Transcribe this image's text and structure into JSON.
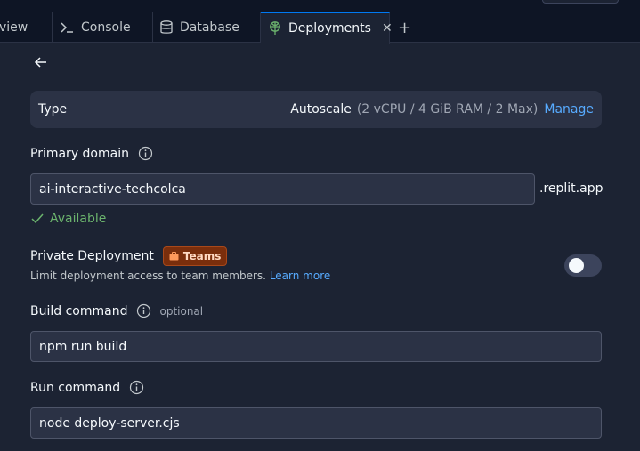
{
  "tabs": [
    {
      "label": "view",
      "icon": "none"
    },
    {
      "label": "Console",
      "icon": "terminal-icon"
    },
    {
      "label": "Database",
      "icon": "database-icon"
    },
    {
      "label": "Deployments",
      "icon": "deployments-icon",
      "active": true
    }
  ],
  "deployment": {
    "type_label": "Type",
    "type_value": "Autoscale",
    "type_detail": "(2 vCPU / 4 GiB RAM / 2 Max)",
    "manage_link": "Manage",
    "primary_domain_label": "Primary domain",
    "domain_value": "ai-interactive-techcolca",
    "domain_suffix": ".replit.app",
    "available_text": "Available",
    "private_label": "Private Deployment",
    "teams_badge": "Teams",
    "private_desc": "Limit deployment access to team members.",
    "learn_more": "Learn more",
    "private_enabled": false,
    "build_label": "Build command",
    "build_optional": "optional",
    "build_value": "npm run build",
    "run_label": "Run command",
    "run_value": "node deploy-server.cjs"
  },
  "colors": {
    "background": "#1c2333",
    "link": "#57abff",
    "success": "#6bb36d",
    "teams_badge_bg": "#7a2e0c"
  }
}
